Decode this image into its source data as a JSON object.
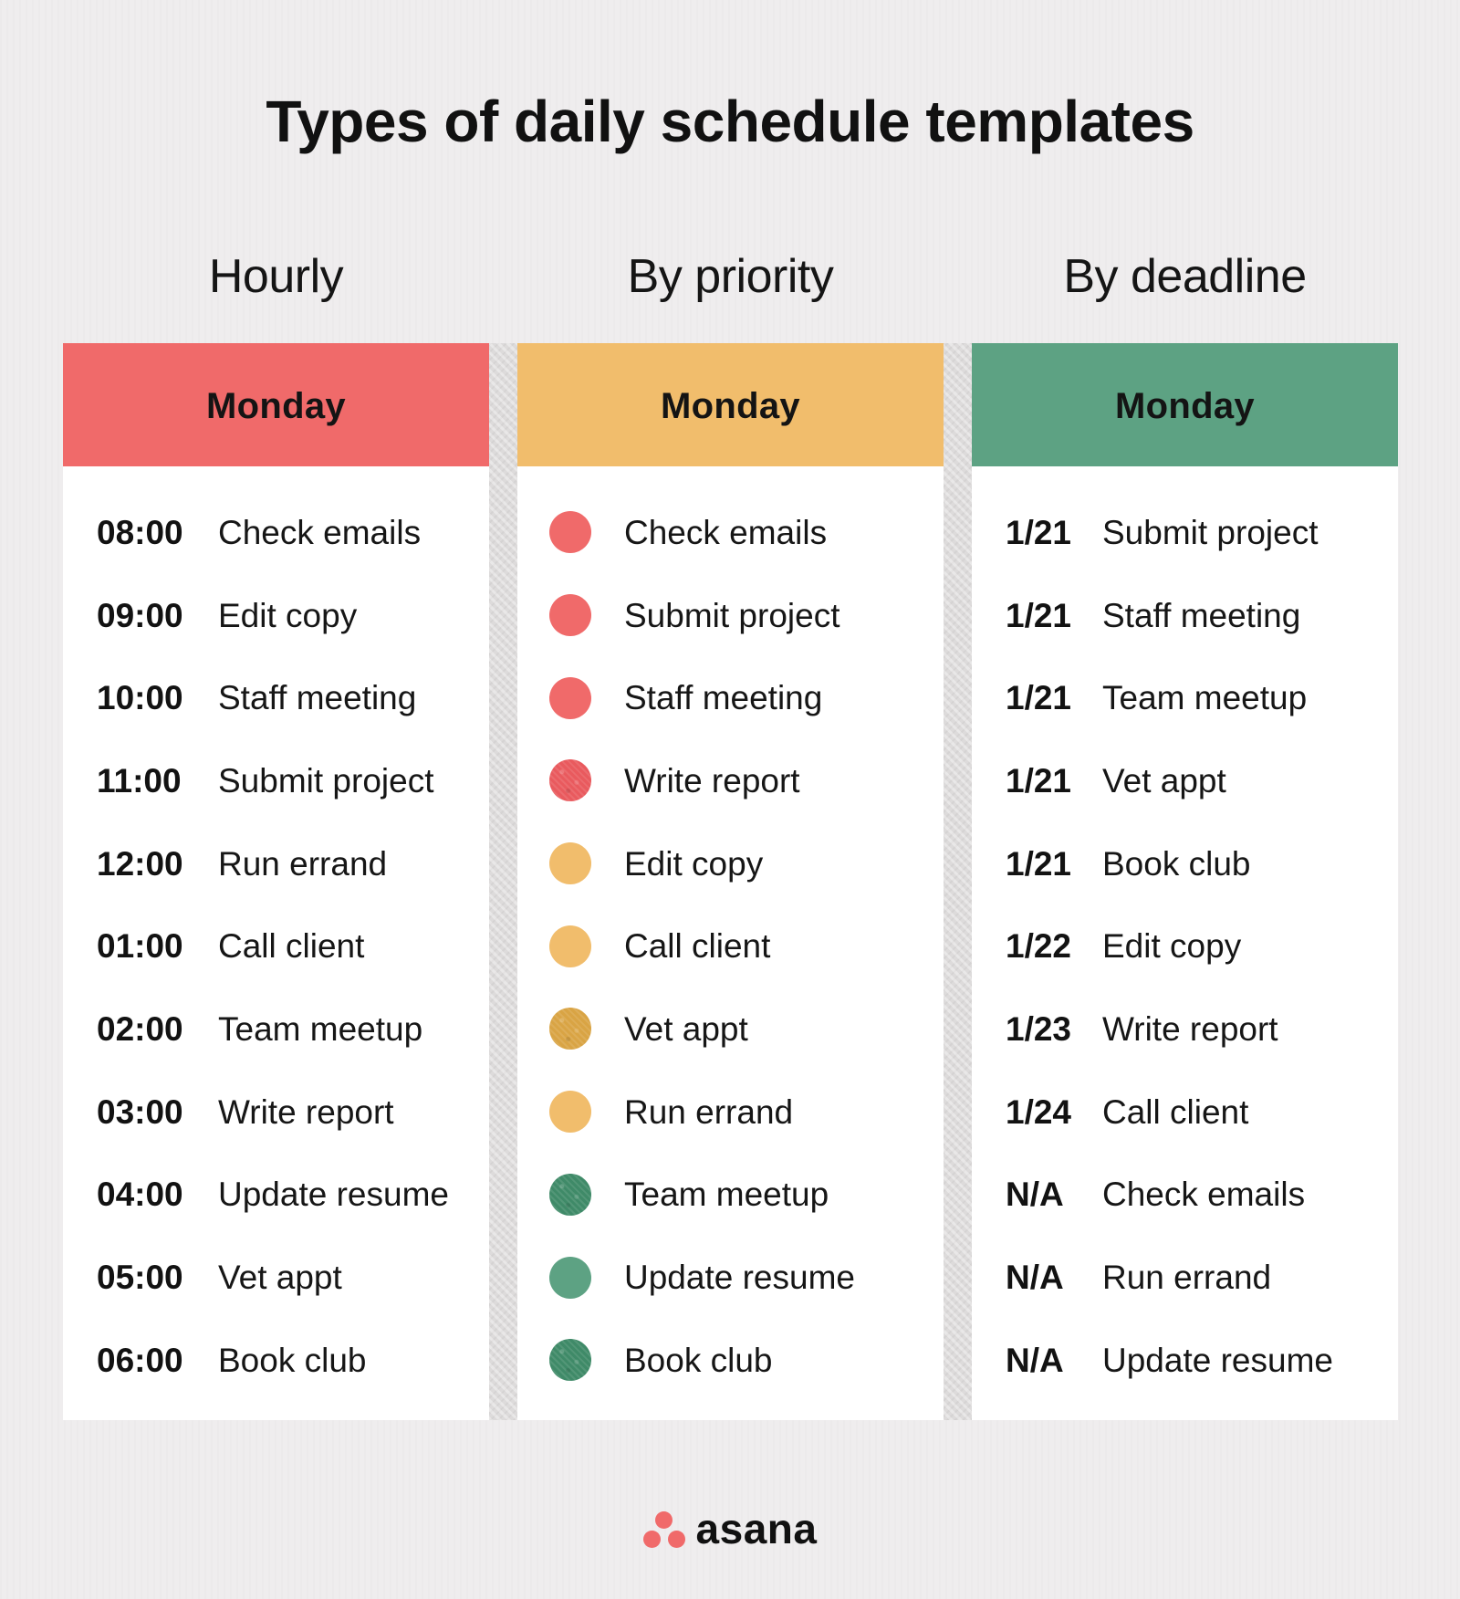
{
  "title": "Types of daily schedule templates",
  "colors": {
    "hourly_header": "#f06a6a",
    "priority_header": "#f1bd6c",
    "deadline_header": "#5da283",
    "high_priority": "#f06a6a",
    "medium_priority": "#f1bd6c",
    "low_priority": "#5da283",
    "low_priority_dark": "#3f8a68",
    "medium_priority_dark": "#d9a444",
    "logo": "#f06a6a"
  },
  "columns": [
    {
      "subtitle": "Hourly",
      "header": "Monday",
      "rows": [
        {
          "lead": "08:00",
          "task": "Check emails"
        },
        {
          "lead": "09:00",
          "task": "Edit copy"
        },
        {
          "lead": "10:00",
          "task": "Staff meeting"
        },
        {
          "lead": "11:00",
          "task": "Submit project"
        },
        {
          "lead": "12:00",
          "task": "Run errand"
        },
        {
          "lead": "01:00",
          "task": "Call client"
        },
        {
          "lead": "02:00",
          "task": "Team meetup"
        },
        {
          "lead": "03:00",
          "task": "Write report"
        },
        {
          "lead": "04:00",
          "task": "Update resume"
        },
        {
          "lead": "05:00",
          "task": "Vet appt"
        },
        {
          "lead": "06:00",
          "task": "Book club"
        }
      ]
    },
    {
      "subtitle": "By priority",
      "header": "Monday",
      "rows": [
        {
          "priority": "high",
          "dot_color": "#f06a6a",
          "textured": false,
          "task": "Check emails"
        },
        {
          "priority": "high",
          "dot_color": "#f06a6a",
          "textured": false,
          "task": "Submit project"
        },
        {
          "priority": "high",
          "dot_color": "#f06a6a",
          "textured": false,
          "task": "Staff meeting"
        },
        {
          "priority": "high",
          "dot_color": "#e95a5e",
          "textured": true,
          "task": "Write report"
        },
        {
          "priority": "medium",
          "dot_color": "#f1bd6c",
          "textured": false,
          "task": "Edit copy"
        },
        {
          "priority": "medium",
          "dot_color": "#f1bd6c",
          "textured": false,
          "task": "Call client"
        },
        {
          "priority": "medium",
          "dot_color": "#d9a444",
          "textured": true,
          "task": "Vet appt"
        },
        {
          "priority": "medium",
          "dot_color": "#f1bd6c",
          "textured": false,
          "task": "Run errand"
        },
        {
          "priority": "low",
          "dot_color": "#3f8a68",
          "textured": true,
          "task": "Team meetup"
        },
        {
          "priority": "low",
          "dot_color": "#5da283",
          "textured": false,
          "task": "Update resume"
        },
        {
          "priority": "low",
          "dot_color": "#3f8a68",
          "textured": true,
          "task": "Book club"
        }
      ]
    },
    {
      "subtitle": "By deadline",
      "header": "Monday",
      "rows": [
        {
          "lead": "1/21",
          "task": "Submit project"
        },
        {
          "lead": "1/21",
          "task": "Staff meeting"
        },
        {
          "lead": "1/21",
          "task": "Team meetup"
        },
        {
          "lead": "1/21",
          "task": "Vet appt"
        },
        {
          "lead": "1/21",
          "task": "Book club"
        },
        {
          "lead": "1/22",
          "task": "Edit copy"
        },
        {
          "lead": "1/23",
          "task": "Write report"
        },
        {
          "lead": "1/24",
          "task": "Call client"
        },
        {
          "lead": "N/A",
          "task": "Check emails"
        },
        {
          "lead": "N/A",
          "task": "Run errand"
        },
        {
          "lead": "N/A",
          "task": "Update resume"
        }
      ]
    }
  ],
  "logo": {
    "icon": "asana-logo-icon",
    "text": "asana"
  }
}
